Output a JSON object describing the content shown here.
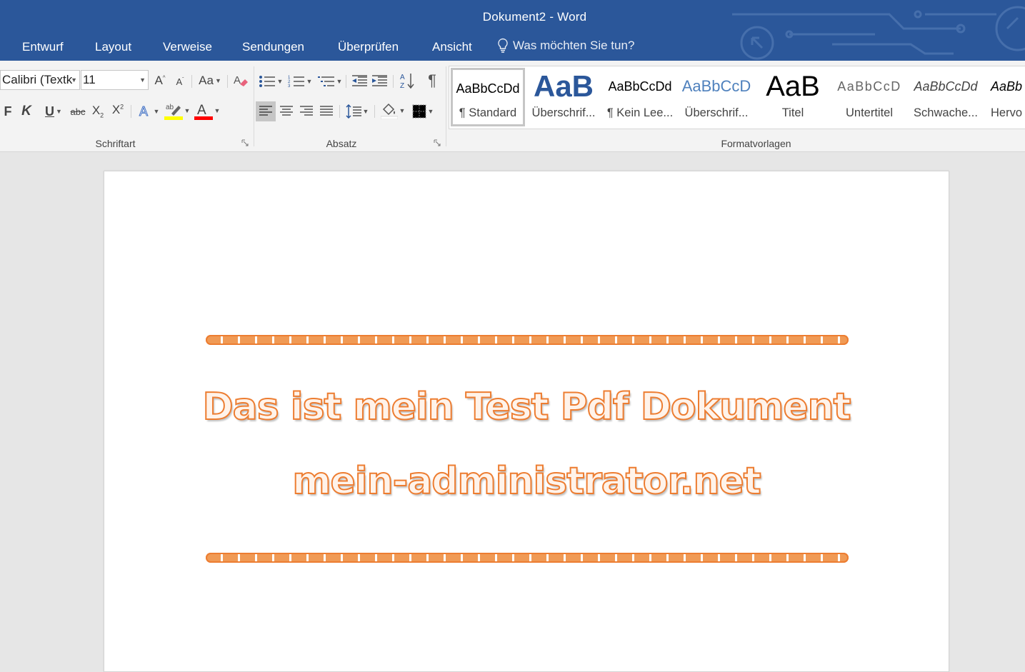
{
  "window": {
    "title": "Dokument2 - Word"
  },
  "tabs": [
    {
      "label": "Entwurf"
    },
    {
      "label": "Layout"
    },
    {
      "label": "Verweise"
    },
    {
      "label": "Sendungen"
    },
    {
      "label": "Überprüfen"
    },
    {
      "label": "Ansicht"
    }
  ],
  "tell_me": {
    "placeholder": "Was möchten Sie tun?",
    "icon": "lightbulb-icon"
  },
  "font_group": {
    "font_name": "Calibri (Textk",
    "font_size": "11",
    "case_label": "Aa",
    "label": "Schriftart",
    "bold_label": "F",
    "italic_label": "K",
    "underline_label": "U",
    "strike_label": "abc",
    "highlight_color": "#ffff00",
    "font_color": "#ff0000"
  },
  "paragraph_group": {
    "label": "Absatz"
  },
  "styles_group": {
    "label": "Formatvorlagen",
    "items": [
      {
        "preview": "AaBbCcDd",
        "name": "¶ Standard"
      },
      {
        "preview": "AaB",
        "name": "Überschrif..."
      },
      {
        "preview": "AaBbCcDd",
        "name": "¶ Kein Lee..."
      },
      {
        "preview": "AaBbCcD",
        "name": "Überschrif..."
      },
      {
        "preview": "AaB",
        "name": "Titel"
      },
      {
        "preview": "AaBbCcD",
        "name": "Untertitel"
      },
      {
        "preview": "AaBbCcDd",
        "name": "Schwache..."
      },
      {
        "preview": "AaBb",
        "name": "Hervo"
      }
    ]
  },
  "document": {
    "line1": "Das ist mein Test Pdf Dokument",
    "line2": "mein-administrator.net",
    "accent": "#ed7d31"
  },
  "colors": {
    "ribbon_blue": "#2b579a",
    "heading_blue": "#2b579a"
  }
}
